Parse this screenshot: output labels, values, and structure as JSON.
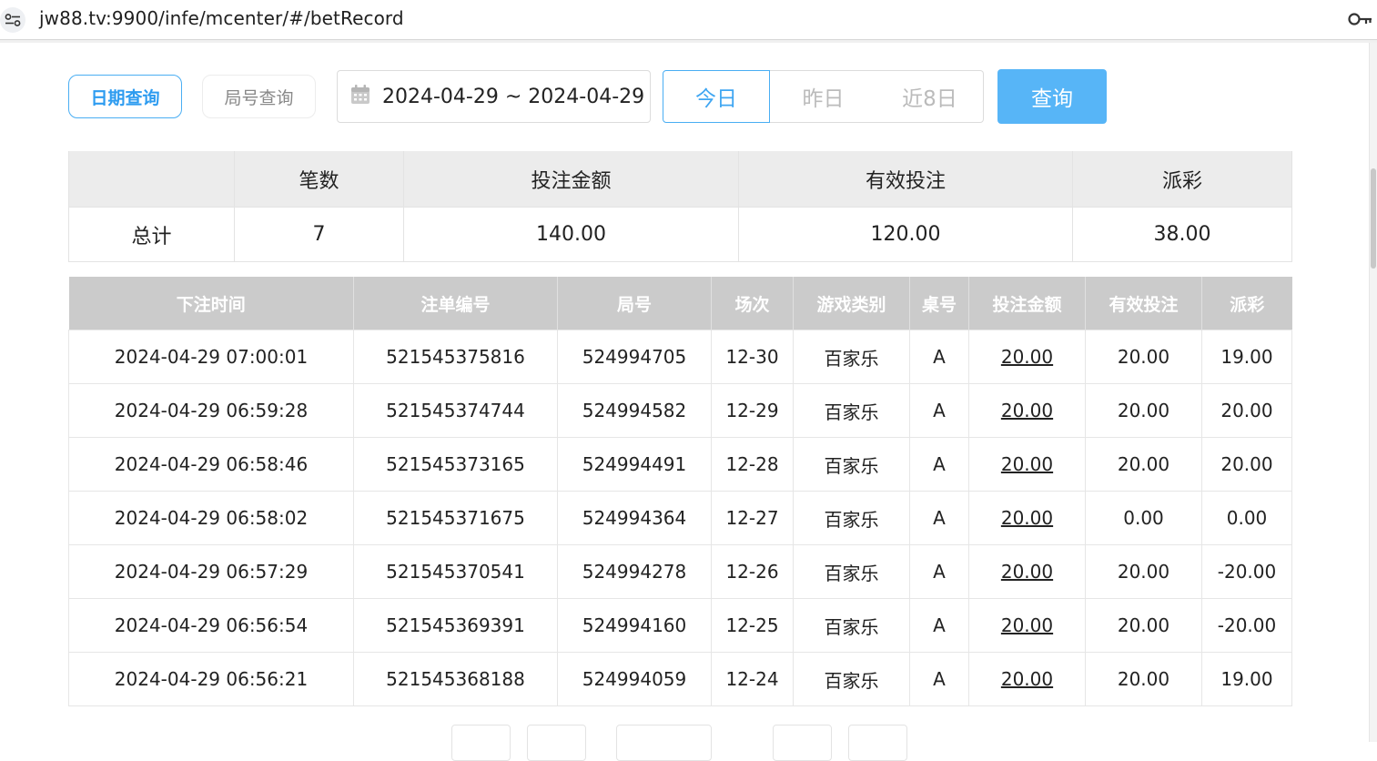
{
  "browser": {
    "url": "jw88.tv:9900/infe/mcenter/#/betRecord"
  },
  "query": {
    "tab_date_label": "日期查询",
    "tab_round_label": "局号查询",
    "date_range": "2024-04-29 ~ 2024-04-29",
    "quick": {
      "today": "今日",
      "yesterday": "昨日",
      "last8": "近8日"
    },
    "search_label": "查询"
  },
  "summary": {
    "headers": [
      "",
      "笔数",
      "投注金额",
      "有效投注",
      "派彩"
    ],
    "row": [
      "总计",
      "7",
      "140.00",
      "120.00",
      "38.00"
    ]
  },
  "records": {
    "headers": [
      "下注时间",
      "注单编号",
      "局号",
      "场次",
      "游戏类别",
      "桌号",
      "投注金额",
      "有效投注",
      "派彩"
    ],
    "rows": [
      [
        "2024-04-29 07:00:01",
        "521545375816",
        "524994705",
        "12-30",
        "百家乐",
        "A",
        "20.00",
        "20.00",
        "19.00"
      ],
      [
        "2024-04-29 06:59:28",
        "521545374744",
        "524994582",
        "12-29",
        "百家乐",
        "A",
        "20.00",
        "20.00",
        "20.00"
      ],
      [
        "2024-04-29 06:58:46",
        "521545373165",
        "524994491",
        "12-28",
        "百家乐",
        "A",
        "20.00",
        "20.00",
        "20.00"
      ],
      [
        "2024-04-29 06:58:02",
        "521545371675",
        "524994364",
        "12-27",
        "百家乐",
        "A",
        "20.00",
        "0.00",
        "0.00"
      ],
      [
        "2024-04-29 06:57:29",
        "521545370541",
        "524994278",
        "12-26",
        "百家乐",
        "A",
        "20.00",
        "20.00",
        "-20.00"
      ],
      [
        "2024-04-29 06:56:54",
        "521545369391",
        "524994160",
        "12-25",
        "百家乐",
        "A",
        "20.00",
        "20.00",
        "-20.00"
      ],
      [
        "2024-04-29 06:56:21",
        "521545368188",
        "524994059",
        "12-24",
        "百家乐",
        "A",
        "20.00",
        "20.00",
        "19.00"
      ]
    ]
  },
  "colors": {
    "accent": "#2e9cf0",
    "search_button": "#57b5f7",
    "negative": "#ee3344",
    "header_bg": "#cbcbcb"
  }
}
